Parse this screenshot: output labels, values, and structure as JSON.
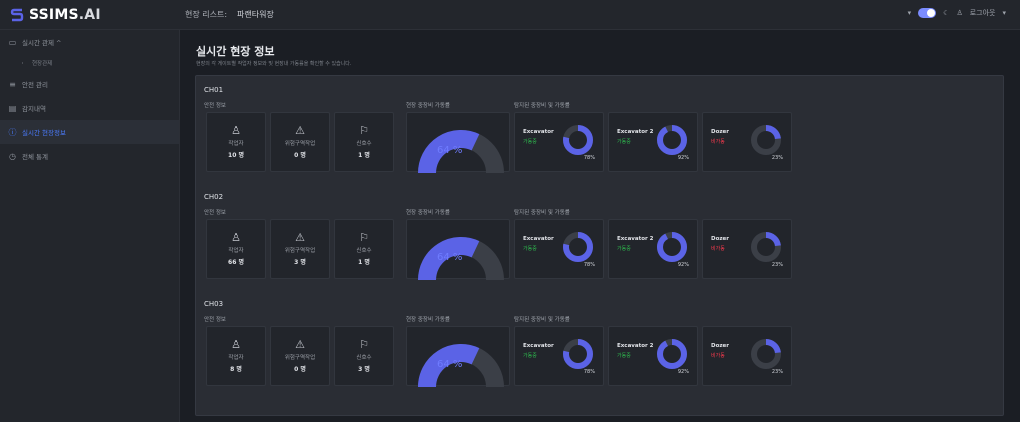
{
  "header": {
    "logo_brand": "SSIMS",
    "logo_suffix": ".AI",
    "site_list_label": "현장 리스트:",
    "site_name": "파랜타워장",
    "logout": "로그아웃"
  },
  "sidebar": {
    "items": [
      {
        "label": "실시간 관제 ^",
        "icon": "monitor-icon"
      },
      {
        "label": "현장관제",
        "icon": "dot-icon"
      },
      {
        "label": "안전 관리",
        "icon": "list-icon"
      },
      {
        "label": "감지내역",
        "icon": "document-icon"
      },
      {
        "label": "실시간 현장정보",
        "icon": "info-icon"
      },
      {
        "label": "전체 통계",
        "icon": "clock-icon"
      }
    ],
    "active_index": 4
  },
  "page": {
    "title": "실시간 현장 정보",
    "subtitle": "현장의 각 게이트별 작업자 정보와 및 현장내 가동률을 확인할 수 있습니다."
  },
  "labels": {
    "safety_info": "안전 정보",
    "site_utilization": "현장 중장비 가동률",
    "equipment_utilization": "탐지된 중장비 및 가동률"
  },
  "sections": [
    {
      "name": "CH01",
      "stats": [
        {
          "label": "작업자",
          "value": "10 명",
          "icon": "person-icon"
        },
        {
          "label": "위험구역작업",
          "value": "0 명",
          "icon": "warning-icon"
        },
        {
          "label": "신호수",
          "value": "1 명",
          "icon": "flag-icon"
        }
      ],
      "site_rate": "64 %",
      "site_rate_value": 64,
      "equipment": [
        {
          "name": "Excavator",
          "status": "가동중",
          "status_color": "#2fbf4f",
          "percent": "78%",
          "value": 78
        },
        {
          "name": "Excavator 2",
          "status": "가동중",
          "status_color": "#2fbf4f",
          "percent": "92%",
          "value": 92
        },
        {
          "name": "Dozer",
          "status": "비가동",
          "status_color": "#ff3b4e",
          "percent": "23%",
          "value": 23
        }
      ]
    },
    {
      "name": "CH02",
      "stats": [
        {
          "label": "작업자",
          "value": "66 명",
          "icon": "person-icon"
        },
        {
          "label": "위험구역작업",
          "value": "3 명",
          "icon": "warning-icon"
        },
        {
          "label": "신호수",
          "value": "1 명",
          "icon": "flag-icon"
        }
      ],
      "site_rate": "64 %",
      "site_rate_value": 64,
      "equipment": [
        {
          "name": "Excavator",
          "status": "가동중",
          "status_color": "#2fbf4f",
          "percent": "78%",
          "value": 78
        },
        {
          "name": "Excavator 2",
          "status": "가동중",
          "status_color": "#2fbf4f",
          "percent": "92%",
          "value": 92
        },
        {
          "name": "Dozer",
          "status": "비가동",
          "status_color": "#ff3b4e",
          "percent": "23%",
          "value": 23
        }
      ]
    },
    {
      "name": "CH03",
      "stats": [
        {
          "label": "작업자",
          "value": "8 명",
          "icon": "person-icon"
        },
        {
          "label": "위험구역작업",
          "value": "0 명",
          "icon": "warning-icon"
        },
        {
          "label": "신호수",
          "value": "3 명",
          "icon": "flag-icon"
        }
      ],
      "site_rate": "64 %",
      "site_rate_value": 64,
      "equipment": [
        {
          "name": "Excavator",
          "status": "가동중",
          "status_color": "#2fbf4f",
          "percent": "78%",
          "value": 78
        },
        {
          "name": "Excavator 2",
          "status": "가동중",
          "status_color": "#2fbf4f",
          "percent": "92%",
          "value": 92
        },
        {
          "name": "Dozer",
          "status": "비가동",
          "status_color": "#ff3b4e",
          "percent": "23%",
          "value": 23
        }
      ]
    }
  ],
  "colors": {
    "accent": "#5b63e6",
    "track": "#3b3f47",
    "active_nav": "#4b7cff"
  }
}
